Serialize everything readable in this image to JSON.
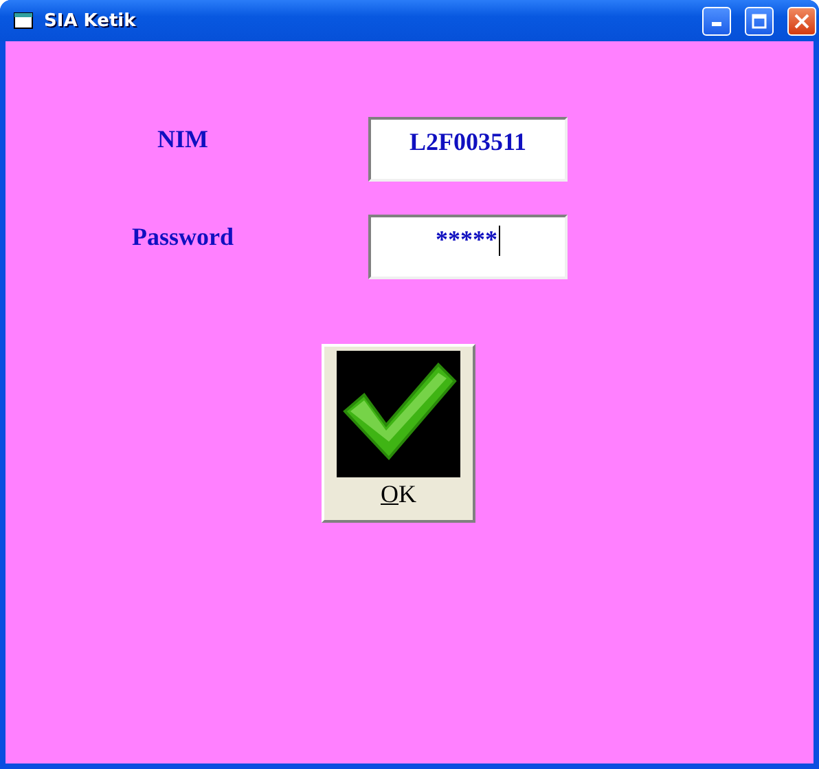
{
  "window": {
    "title": "SIA Ketik"
  },
  "fields": [
    {
      "label": "NIM",
      "value": "L2F003511",
      "focused": false
    },
    {
      "label": "Password",
      "value": "*****",
      "focused": true
    }
  ],
  "buttons": [
    {
      "label": "OK"
    }
  ]
}
